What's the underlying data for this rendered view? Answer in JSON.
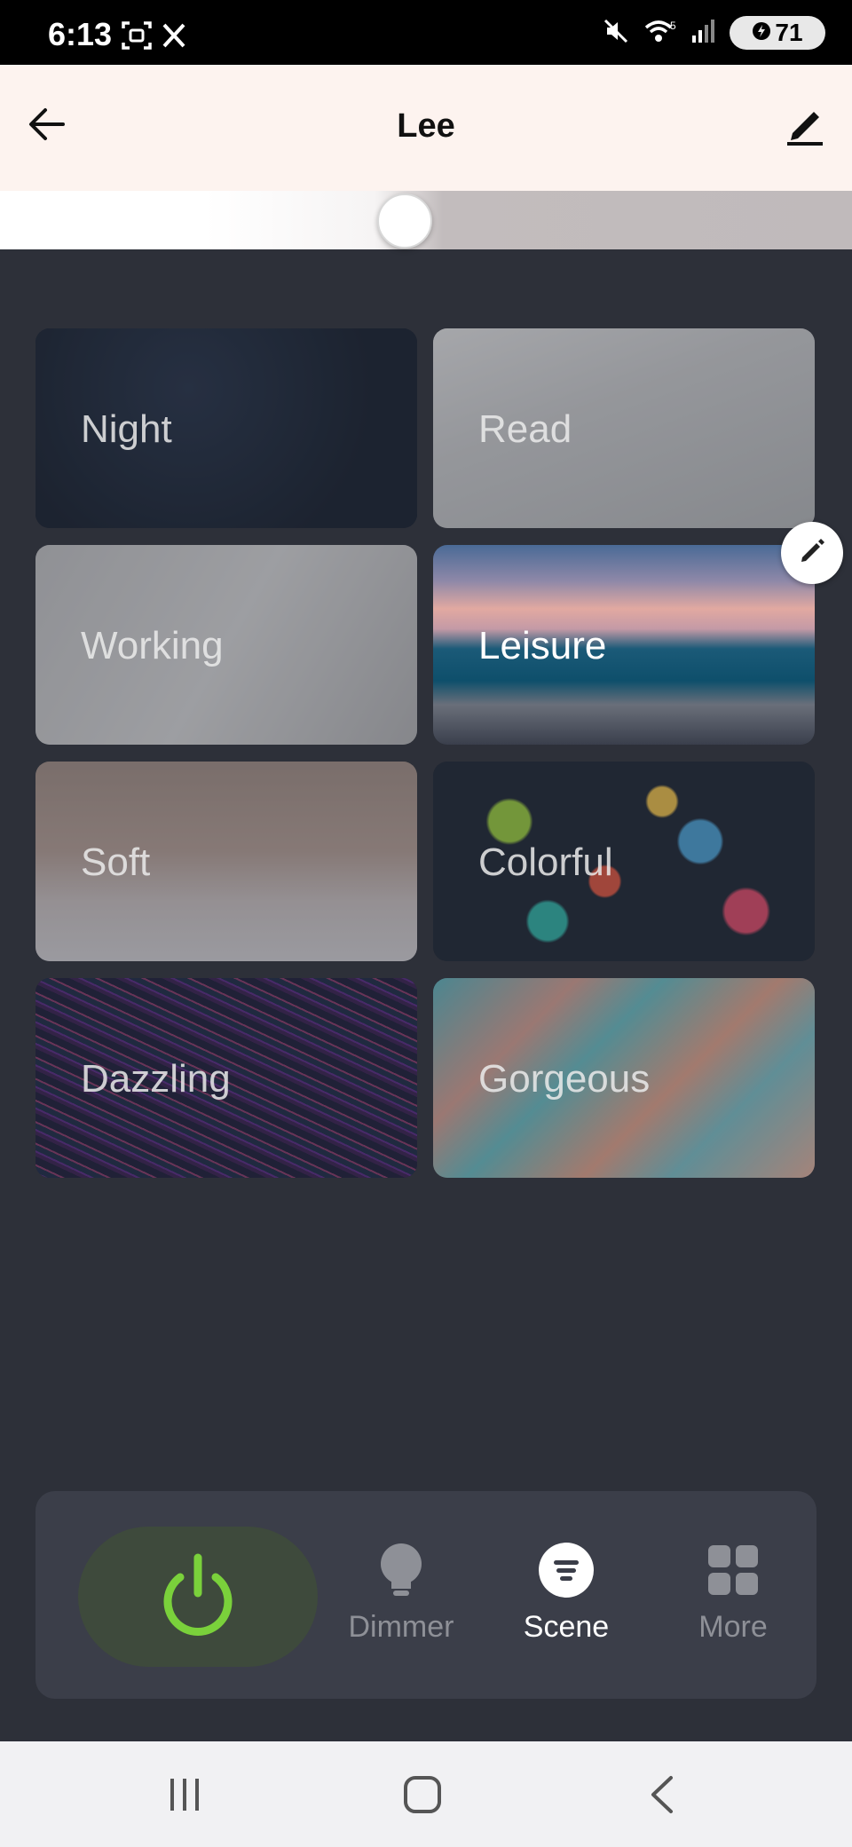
{
  "status_bar": {
    "time": "6:13",
    "battery": "71"
  },
  "header": {
    "title": "Lee"
  },
  "brightness": {
    "level": 0.475
  },
  "scenes": [
    {
      "label": "Night"
    },
    {
      "label": "Read"
    },
    {
      "label": "Working"
    },
    {
      "label": "Leisure",
      "active": true
    },
    {
      "label": "Soft"
    },
    {
      "label": "Colorful"
    },
    {
      "label": "Dazzling"
    },
    {
      "label": "Gorgeous"
    }
  ],
  "bottom_nav": {
    "dimmer_label": "Dimmer",
    "scene_label": "Scene",
    "more_label": "More"
  },
  "colors": {
    "power_green": "#7ad13b",
    "background": "#2d3039",
    "header_bg": "#fdf3ef"
  }
}
